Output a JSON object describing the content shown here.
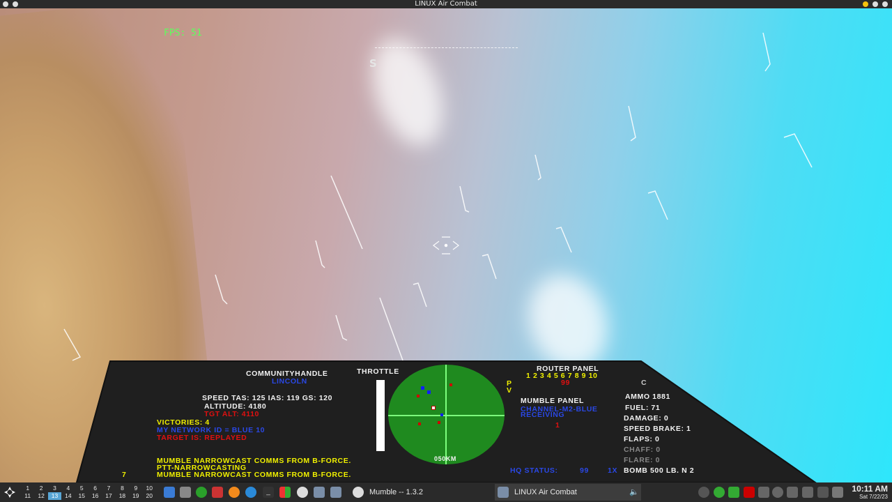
{
  "window": {
    "title": "LINUX Air Combat"
  },
  "hud": {
    "fps": "FPS: 51",
    "heading_letter": "S"
  },
  "cockpit": {
    "callsign_label": "COMMUNITYHANDLE",
    "callsign_name": "LINCOLN",
    "speed_line": "SPEED   TAS: 125   IAS: 119   GS: 120",
    "altitude_line": "ALTITUDE:   4180",
    "tgt_alt_line": "TGT ALT:   4110",
    "victories": "VICTORIES: 4",
    "network_id": "MY NETWORK ID = BLUE 10",
    "target_line": "TARGET IS: REPLAYED",
    "mumble_msg_1": "MUMBLE NARROWCAST COMMS FROM B-FORCE.",
    "ptt_msg": "PTT-NARROWCASTING",
    "mumble_msg_2": "MUMBLE NARROWCAST COMMS FROM B-FORCE.",
    "msg_count": "7",
    "throttle_label": "THROTTLE",
    "throttle_fraction": 1.0,
    "radar_range": "050KM",
    "pv_p": "P",
    "pv_v": "V",
    "router_panel_label": "ROUTER PANEL",
    "router_channels": "1 2 3 4 5  6 7 8 9 10",
    "router_selected": "99",
    "router_c": "C",
    "mumble_panel_label": "MUMBLE PANEL",
    "mumble_channel": "CHANNEL-M2-BLUE",
    "mumble_receiving": "RECEIVING",
    "mumble_count": "1",
    "hq_status_label": "HQ STATUS:",
    "hq_status_value": "99",
    "hq_multiplier": "1X",
    "ammo": "AMMO  1881",
    "fuel": "FUEL:     71",
    "damage": "DAMAGE:     0",
    "speed_brake": "SPEED BRAKE: 1",
    "flaps": "FLAPS:   0",
    "chaff": "CHAFF:  0",
    "flare": "FLARE:  0",
    "bomb": "BOMB 500 LB.   N 2"
  },
  "taskbar": {
    "workspaces_row1": [
      "1",
      "2",
      "3",
      "4",
      "5",
      "6",
      "7",
      "8",
      "9",
      "10"
    ],
    "workspaces_row2": [
      "11",
      "12",
      "13",
      "14",
      "15",
      "16",
      "17",
      "18",
      "19",
      "20"
    ],
    "active_workspace": "13",
    "task_mumble": "Mumble -- 1.3.2",
    "task_lac": "LINUX Air Combat",
    "clock_time": "10:11 AM",
    "clock_date": "Sat 7/22/23"
  },
  "colors": {
    "hud_green": "#5dff5d",
    "radar_green": "#1f8a1f",
    "panel_bg": "#1f1f1f",
    "blue_text": "#2a48e6",
    "red_text": "#e01010",
    "yellow_text": "#f0f000",
    "workspace_active": "#58a6d6"
  }
}
